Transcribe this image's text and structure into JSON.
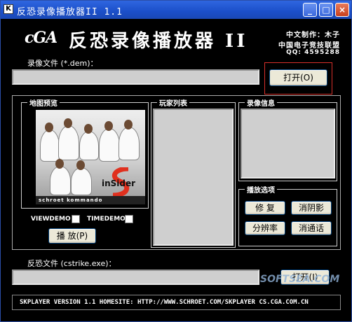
{
  "window": {
    "title": "反恐录像播放器II 1.1",
    "controls": {
      "minimize": "_",
      "maximize": "□",
      "close": "×"
    }
  },
  "header": {
    "logo": "cGA",
    "app_title": "反恐录像播放器 II",
    "credit_line1": "中文制作：木子",
    "credit_line2": "中国电子竞技联盟",
    "credit_qq": "QQ: 4595288"
  },
  "demo_file": {
    "label": "录像文件 (*.dem)：",
    "value": "",
    "open_button": "打开(O)"
  },
  "map_preview": {
    "label": "地图预览",
    "banner": "schroet kommando",
    "brand": "inSider"
  },
  "options": {
    "viewdemo_label": "VIEWDEMO",
    "timedemo_label": "TIMEDEMO",
    "play_button": "播 放(P)"
  },
  "players": {
    "label": "玩家列表"
  },
  "demo_info": {
    "label": "录像信息"
  },
  "play_options": {
    "label": "播放选项",
    "repair_button": "修 复",
    "shadow_button": "消阴影",
    "resolution_button": "分辨率",
    "chat_button": "消通话"
  },
  "exe_file": {
    "label": "反恐文件 (cstrike.exe)：",
    "value": "",
    "open_button": "打开(I)"
  },
  "footer": {
    "text": "SKPLAYER VERSION 1.1   HOMESITE: HTTP://WWW.SCHROET.COM/SKPLAYER   CS.CGA.COM.CN"
  },
  "watermark": "SOFTSEA.COM"
}
